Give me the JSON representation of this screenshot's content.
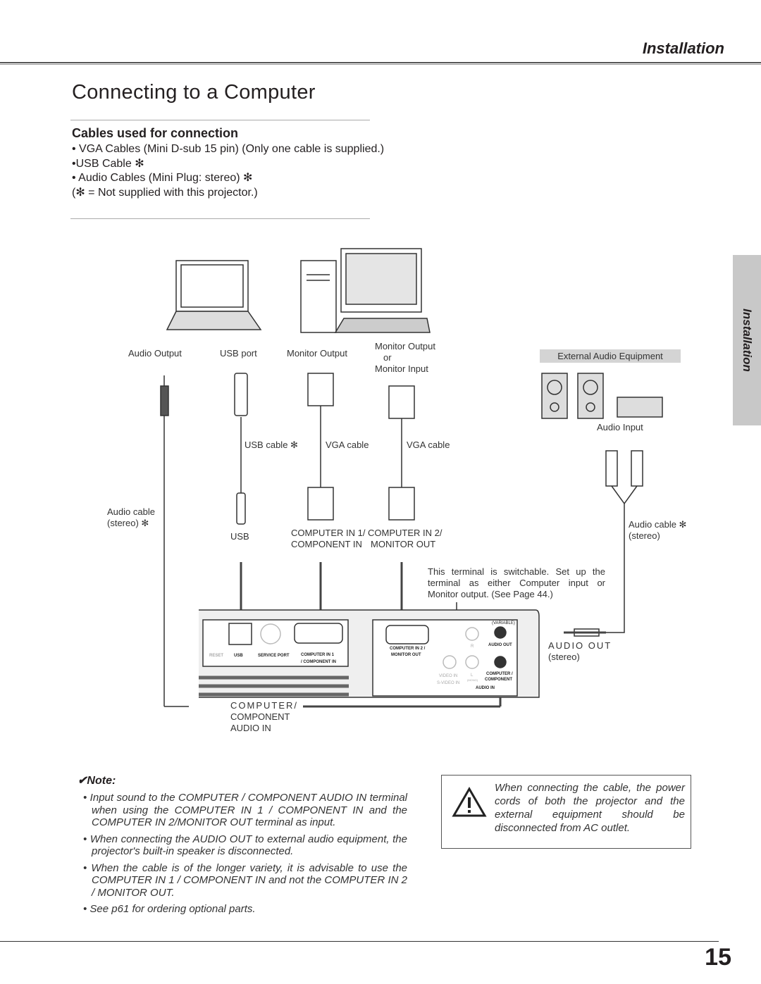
{
  "header": {
    "section": "Installation"
  },
  "page": {
    "title": "Connecting to a Computer",
    "number": "15",
    "side_tab": "Installation"
  },
  "cables": {
    "heading": "Cables used for connection",
    "items": [
      "• VGA Cables (Mini D-sub 15 pin) (Only one cable is supplied.)",
      "•USB Cable ✻",
      "• Audio Cables (Mini Plug: stereo) ✻",
      "(✻ = Not supplied with this projector.)"
    ]
  },
  "diagram": {
    "audio_output": "Audio Output",
    "usb_port": "USB port",
    "monitor_output": "Monitor Output",
    "monitor_output2": "Monitor Output",
    "or": "or",
    "monitor_input": "Monitor Input",
    "external_audio": "External Audio Equipment",
    "audio_input": "Audio Input",
    "usb_cable": "USB cable ✻",
    "vga_cable1": "VGA cable",
    "vga_cable2": "VGA cable",
    "audio_cable_left": "Audio cable",
    "stereo_left": "(stereo) ✻",
    "usb": "USB",
    "comp_in1_a": "COMPUTER IN 1/",
    "comp_in1_b": "COMPONENT IN",
    "comp_in2_a": "COMPUTER IN 2/",
    "comp_in2_b": "MONITOR OUT",
    "audio_cable_right": "Audio cable ✻",
    "stereo_right": "(stereo)",
    "switchable": "This terminal is switchable. Set up the terminal as either Computer input or Monitor output.  (See Page 44.)",
    "audio_out": "AUDIO  OUT",
    "audio_out_stereo": "(stereo)",
    "ca_in_1": "COMPUTER/",
    "ca_in_2": "COMPONENT",
    "ca_in_3": "AUDIO IN",
    "panel": {
      "reset": "RESET",
      "usb": "USB",
      "service_port": "SERVICE PORT",
      "comp_in1": "COMPUTER  IN 1",
      "comp_in1b": "/ COMPONENT IN",
      "comp_in2": "COMPUTER IN 2 /",
      "monitor_out": "MONITOR  OUT",
      "variable": "(VARIABLE)",
      "audio_out": "AUDIO  OUT",
      "r": "R",
      "l": "L",
      "mono": "(MONO)",
      "video_in": "VIDEO IN",
      "svideo_in": "S-VIDEO IN",
      "comp_comp": "COMPUTER /",
      "component": "COMPONENT",
      "audio_in": "AUDIO  IN"
    }
  },
  "note": {
    "heading": "✔Note:",
    "items": [
      "• Input sound to the COMPUTER / COMPONENT AUDIO IN terminal when using the COMPUTER IN 1 / COMPONENT IN and the COMPUTER IN 2/MONITOR OUT terminal as input.",
      "• When connecting the AUDIO OUT to external audio equipment, the projector's built-in speaker is disconnected.",
      "• When the cable is of the longer variety, it is advisable to use the COMPUTER IN 1 / COMPONENT IN and not the COMPUTER IN 2 / MONITOR OUT.",
      "• See p61 for ordering optional parts."
    ]
  },
  "warning": {
    "text": "When connecting the cable, the power cords of both the projector and the external equipment should be disconnected from AC outlet."
  }
}
